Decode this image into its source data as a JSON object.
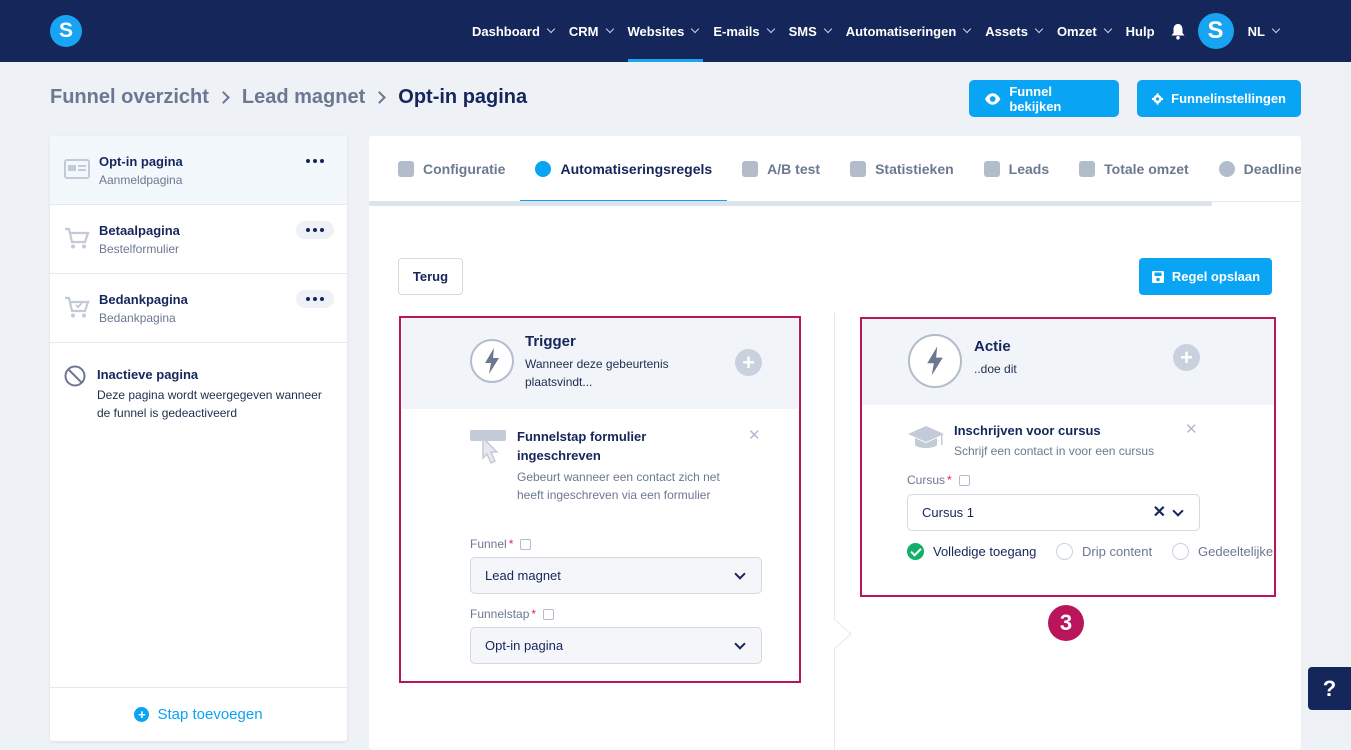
{
  "nav": {
    "items": [
      "Dashboard",
      "CRM",
      "Websites",
      "E-mails",
      "SMS",
      "Automatiseringen",
      "Assets",
      "Omzet"
    ],
    "help": "Hulp",
    "avatar_letter": "S",
    "language": "NL",
    "logo_letter": "S"
  },
  "breadcrumb": [
    "Funnel overzicht",
    "Lead magnet",
    "Opt-in pagina"
  ],
  "header_buttons": {
    "view": "Funnel bekijken",
    "settings": "Funnelinstellingen"
  },
  "sidebar": {
    "steps": [
      {
        "title": "Opt-in pagina",
        "subtitle": "Aanmeldpagina"
      },
      {
        "title": "Betaalpagina",
        "subtitle": "Bestelformulier"
      },
      {
        "title": "Bedankpagina",
        "subtitle": "Bedankpagina"
      }
    ],
    "inactive": {
      "title": "Inactieve pagina",
      "description": "Deze pagina wordt weergegeven wanneer de funnel is gedeactiveerd"
    },
    "add_step": "Stap toevoegen"
  },
  "tabs": [
    "Configuratie",
    "Automatiseringsregels",
    "A/B test",
    "Statistieken",
    "Leads",
    "Totale omzet",
    "Deadline"
  ],
  "actions": {
    "back": "Terug",
    "save": "Regel opslaan"
  },
  "trigger": {
    "title": "Trigger",
    "subtitle": "Wanneer deze gebeurtenis plaatsvindt...",
    "item_title": "Funnelstap formulier ingeschreven",
    "item_desc": "Gebeurt wanneer een contact zich net heeft ingeschreven via een formulier",
    "funnel_label": "Funnel",
    "funnel_value": "Lead magnet",
    "step_label": "Funnelstap",
    "step_value": "Opt-in pagina"
  },
  "action": {
    "title": "Actie",
    "subtitle": "..doe dit",
    "item_title": "Inschrijven voor cursus",
    "item_desc": "Schrijf een contact in voor een cursus",
    "course_label": "Cursus",
    "course_value": "Cursus 1",
    "access_options": [
      "Volledige toegang",
      "Drip content",
      "Gedeeltelijke"
    ],
    "selected_access": "Volledige toegang"
  },
  "annotation_badge": "3",
  "help_button": "?",
  "colors": {
    "navy": "#15265b",
    "accent": "#0aa4f4",
    "highlight": "#b8155b",
    "success": "#10b06b"
  }
}
